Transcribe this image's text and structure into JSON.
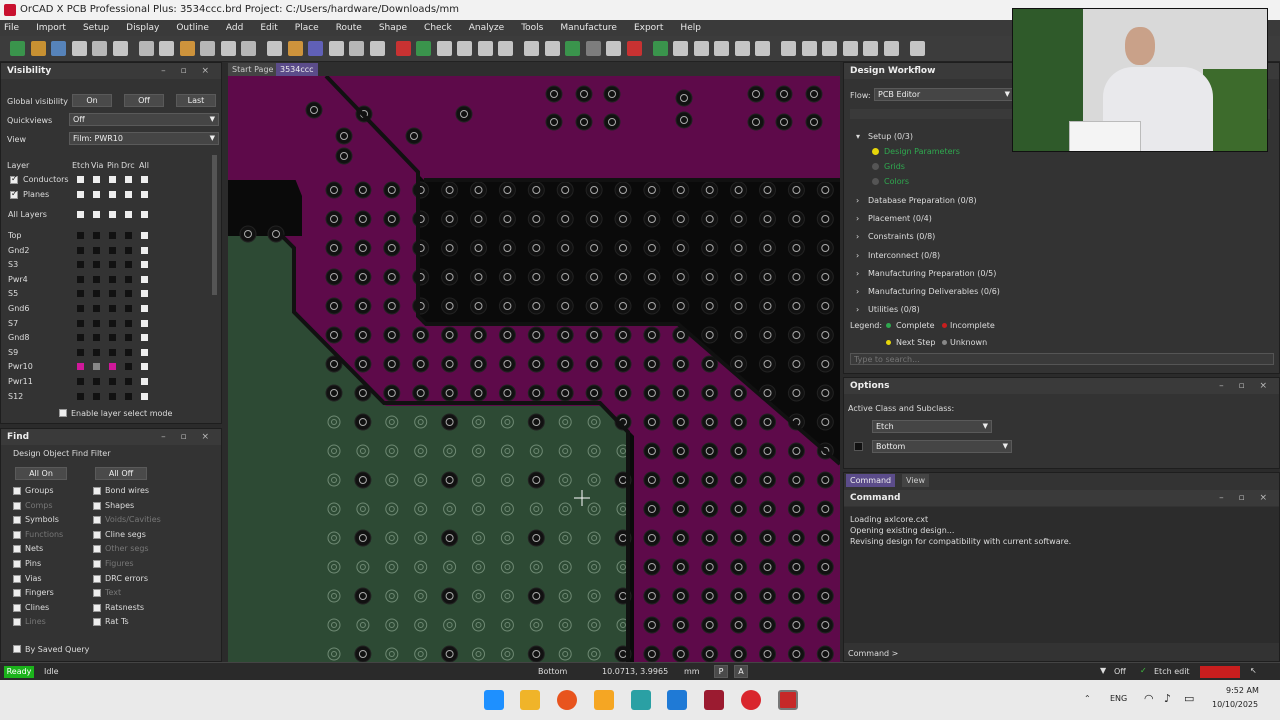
{
  "window": {
    "title": "OrCAD X PCB Professional Plus: 3534ccc.brd  Project: C:/Users/hardware/Downloads/mm"
  },
  "menu": [
    "File",
    "Import",
    "Setup",
    "Display",
    "Outline",
    "Add",
    "Edit",
    "Place",
    "Route",
    "Shape",
    "Check",
    "Analyze",
    "Tools",
    "Manufacture",
    "Export",
    "Help"
  ],
  "tabs": {
    "start": "Start Page",
    "file": "3534ccc"
  },
  "visibility": {
    "title": "Visibility",
    "ctl": "– ▫ ×",
    "global_label": "Global visibility",
    "on": "On",
    "off": "Off",
    "last": "Last",
    "quickviews_label": "Quickviews",
    "quickviews_value": "Off",
    "view_label": "View",
    "view_value": "Film: PWR10",
    "layer_hdr": "Layer",
    "col_hdrs": [
      "Etch",
      "Via",
      "Pin",
      "Drc",
      "All"
    ],
    "conductors": "Conductors",
    "planes": "Planes",
    "all_layers": "All Layers",
    "layers": [
      "Top",
      "Gnd2",
      "S3",
      "Pwr4",
      "S5",
      "Gnd6",
      "S7",
      "Gnd8",
      "S9",
      "Pwr10",
      "Pwr11",
      "S12"
    ],
    "enable_select": "Enable layer select mode"
  },
  "find": {
    "title": "Find",
    "ctl": "– ▫ ×",
    "filter_title": "Design Object Find Filter",
    "all_on": "All On",
    "all_off": "All Off",
    "left": [
      "Groups",
      "Comps",
      "Symbols",
      "Functions",
      "Nets",
      "Pins",
      "Vias",
      "Fingers",
      "Clines",
      "Lines"
    ],
    "right": [
      "Bond wires",
      "Shapes",
      "Voids/Cavities",
      "Cline segs",
      "Other segs",
      "Figures",
      "DRC errors",
      "Text",
      "Ratsnests",
      "Rat Ts"
    ],
    "saved_query": "By Saved Query"
  },
  "workflow": {
    "title": "Design Workflow",
    "ctl": "– ▫ ×",
    "flow_label": "Flow:",
    "flow_value": "PCB Editor",
    "setup": "Setup  (0/3)",
    "setup_items": [
      "Design Parameters",
      "Grids",
      "Colors"
    ],
    "groups": [
      "Database Preparation  (0/8)",
      "Placement  (0/4)",
      "Constraints  (0/8)",
      "Interconnect  (0/8)",
      "Manufacturing Preparation  (0/5)",
      "Manufacturing Deliverables  (0/6)",
      "Utilities  (0/8)"
    ],
    "legend_label": "Legend:",
    "complete": "Complete",
    "incomplete": "Incomplete",
    "next": "Next Step",
    "unknown": "Unknown",
    "search_placeholder": "Type to search..."
  },
  "options": {
    "title": "Options",
    "ctl": "– ▫ ×",
    "active_label": "Active Class and Subclass:",
    "class_value": "Etch",
    "subclass_value": "Bottom"
  },
  "command": {
    "tab_command": "Command",
    "tab_view": "View",
    "title": "Command",
    "ctl": "– ▫ ×",
    "lines": [
      "Loading axlcore.cxt",
      "Opening existing design...",
      "Revising design for compatibility with current software."
    ],
    "prompt": "Command >"
  },
  "status": {
    "ready": "Ready",
    "idle": "Idle",
    "layer": "Bottom",
    "coords": "10.0713, 3.9965",
    "units": "mm",
    "p": "P",
    "a": "A",
    "off": "Off",
    "mode": "Etch edit"
  },
  "taskbar": {
    "lang": "ENG",
    "time": "9:52 AM",
    "date": "10/10/2025"
  },
  "colors": {
    "plane_magenta": "#5e0a4a",
    "plane_green": "#2d4a34",
    "accent": "#5b4c8a",
    "ready": "#1bb31b"
  }
}
